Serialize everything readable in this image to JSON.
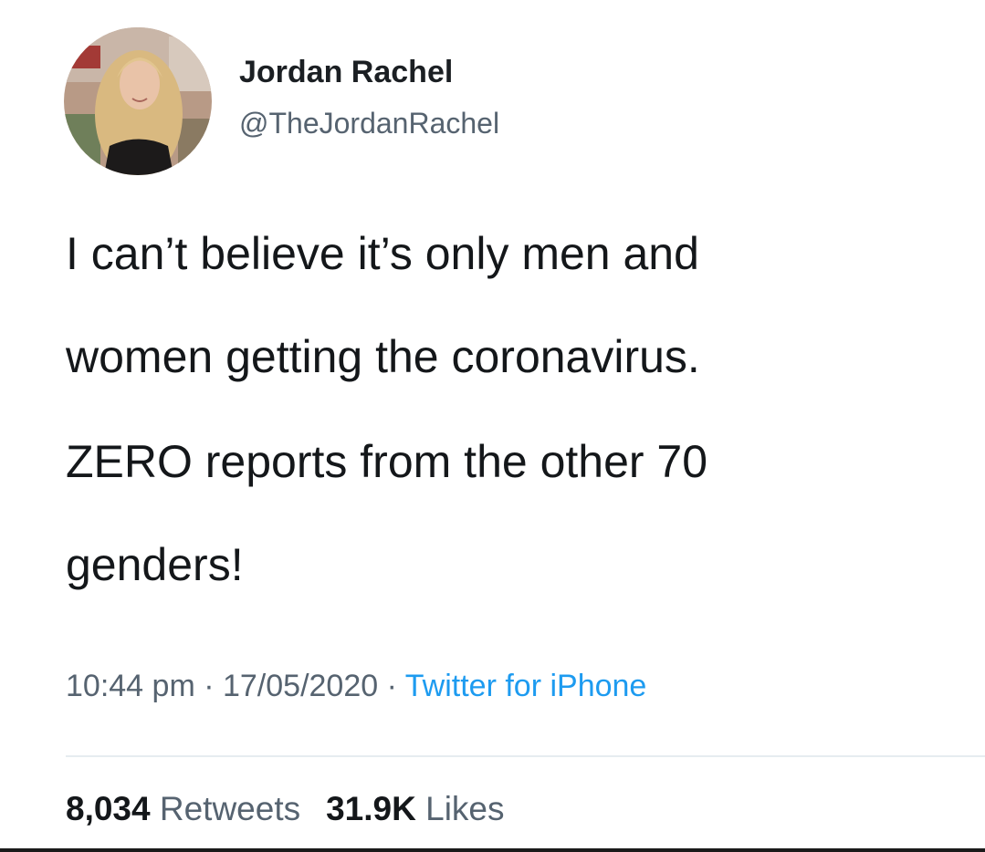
{
  "user": {
    "display_name": "Jordan Rachel",
    "handle": "@TheJordanRachel",
    "avatar_icon": "profile-photo"
  },
  "tweet": {
    "lines": [
      "I can’t believe it’s only men and",
      "women getting the coronavirus.",
      "ZERO reports from the other 70",
      "genders!"
    ]
  },
  "meta": {
    "time": "10:44 pm",
    "separator": " · ",
    "date": "17/05/2020",
    "source": "Twitter for iPhone"
  },
  "stats": {
    "retweets_count": "8,034",
    "retweets_label": "Retweets",
    "likes_count": "31.9K",
    "likes_label": "Likes"
  },
  "colors": {
    "text": "#14171a",
    "secondary": "#566370",
    "link": "#1d9bf0",
    "divider": "#e6ecf0"
  }
}
